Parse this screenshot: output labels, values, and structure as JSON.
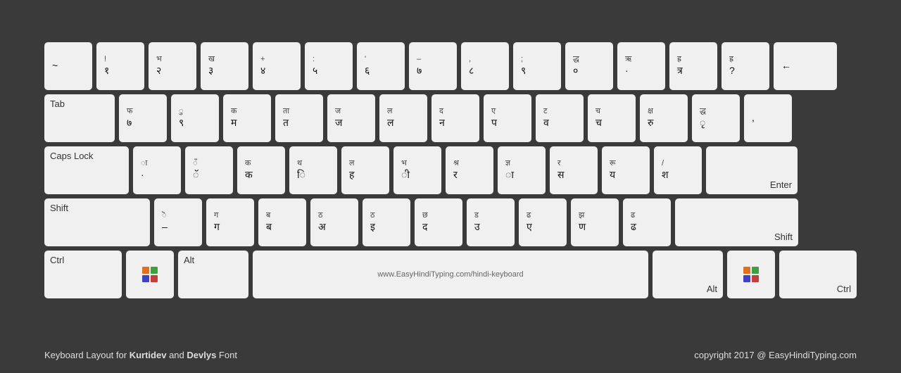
{
  "keyboard": {
    "rows": [
      {
        "id": "row1",
        "keys": [
          {
            "id": "backtick",
            "top": "",
            "bottom": "~",
            "w": "w1"
          },
          {
            "id": "1",
            "top": "!",
            "bottom": "१",
            "w": "w1"
          },
          {
            "id": "2",
            "top": "भ",
            "bottom": "२",
            "w": "w1"
          },
          {
            "id": "3",
            "top": "ख",
            "bottom": "३",
            "w": "w1"
          },
          {
            "id": "4",
            "top": "+",
            "bottom": "४",
            "w": "w1"
          },
          {
            "id": "5",
            "top": ":",
            "bottom": "५",
            "w": "w1"
          },
          {
            "id": "6",
            "top": "'",
            "bottom": "६",
            "w": "w1"
          },
          {
            "id": "7",
            "top": "–",
            "bottom": "७",
            "w": "w1"
          },
          {
            "id": "8",
            "top": ",",
            "bottom": "८",
            "w": "w1"
          },
          {
            "id": "9",
            "top": ";",
            "bottom": "९",
            "w": "w1"
          },
          {
            "id": "0",
            "top": "द्ध",
            "bottom": "०",
            "w": "w1"
          },
          {
            "id": "minus",
            "top": "ऋ",
            "bottom": "·",
            "w": "w1"
          },
          {
            "id": "equal",
            "top": "ह्र",
            "bottom": "त्र",
            "w": "w1"
          },
          {
            "id": "plus2",
            "top": "ह्र",
            "bottom": "?",
            "w": "w1"
          },
          {
            "id": "backspace",
            "top": "",
            "bottom": "←",
            "w": "w-back",
            "special": true
          }
        ]
      },
      {
        "id": "row2",
        "keys": [
          {
            "id": "tab",
            "label": "Tab",
            "w": "w-tab",
            "special": true
          },
          {
            "id": "q",
            "top": "फ",
            "bottom": "७",
            "w": "w1"
          },
          {
            "id": "w",
            "top": "ु",
            "bottom": "९",
            "w": "w1"
          },
          {
            "id": "e",
            "top": "क",
            "bottom": "म",
            "w": "w1"
          },
          {
            "id": "r",
            "top": "ता",
            "bottom": "त",
            "w": "w1"
          },
          {
            "id": "t",
            "top": "ज",
            "bottom": "ज",
            "w": "w1"
          },
          {
            "id": "y",
            "top": "ल",
            "bottom": "ल",
            "w": "w1"
          },
          {
            "id": "u",
            "top": "द",
            "bottom": "न",
            "w": "w1"
          },
          {
            "id": "i",
            "top": "ए",
            "bottom": "प",
            "w": "w1"
          },
          {
            "id": "o",
            "top": "ट",
            "bottom": "व",
            "w": "w1"
          },
          {
            "id": "p",
            "top": "च",
            "bottom": "च",
            "w": "w1"
          },
          {
            "id": "bracketl",
            "top": "क्ष",
            "bottom": "रु",
            "w": "w1"
          },
          {
            "id": "bracketr",
            "top": "द्ध",
            "bottom": "ृ",
            "w": "w1"
          },
          {
            "id": "backslash",
            "top": "",
            "bottom": ",",
            "w": "w1"
          }
        ]
      },
      {
        "id": "row3",
        "keys": [
          {
            "id": "capslock",
            "label": "Caps Lock",
            "w": "w-caps",
            "special": true
          },
          {
            "id": "a",
            "top": "ा",
            "bottom": "·",
            "w": "w1"
          },
          {
            "id": "s",
            "top": "ँ",
            "bottom": "ॅ",
            "w": "w1"
          },
          {
            "id": "d",
            "top": "क",
            "bottom": "क",
            "w": "w1"
          },
          {
            "id": "f",
            "top": "थ",
            "bottom": "ि",
            "w": "w1"
          },
          {
            "id": "g",
            "top": "ल",
            "bottom": "ह",
            "w": "w1"
          },
          {
            "id": "h",
            "top": "भ",
            "bottom": "ी",
            "w": "w1"
          },
          {
            "id": "j",
            "top": "श्र",
            "bottom": "र",
            "w": "w1"
          },
          {
            "id": "k",
            "top": "ज्ञ",
            "bottom": "ा",
            "w": "w1"
          },
          {
            "id": "l",
            "top": "र",
            "bottom": "स",
            "w": "w1"
          },
          {
            "id": "semicolon",
            "top": "रू",
            "bottom": "य",
            "w": "w1"
          },
          {
            "id": "quote",
            "top": "/",
            "bottom": "श",
            "w": "w1"
          },
          {
            "id": "enter",
            "label": "Enter",
            "w": "w-enter",
            "special": true
          }
        ]
      },
      {
        "id": "row4",
        "keys": [
          {
            "id": "shiftl",
            "label": "Shift",
            "w": "w-shift-l",
            "special": true
          },
          {
            "id": "z",
            "top": "ॆ",
            "bottom": "–",
            "w": "w1"
          },
          {
            "id": "x",
            "top": "ग",
            "bottom": "ग",
            "w": "w1"
          },
          {
            "id": "c",
            "top": "ब",
            "bottom": "ब",
            "w": "w1"
          },
          {
            "id": "v",
            "top": "ठ",
            "bottom": "अ",
            "w": "w1"
          },
          {
            "id": "b",
            "top": "ठ",
            "bottom": "इ",
            "w": "w1"
          },
          {
            "id": "n",
            "top": "छ",
            "bottom": "द",
            "w": "w1"
          },
          {
            "id": "m",
            "top": "ड",
            "bottom": "उ",
            "w": "w1"
          },
          {
            "id": "comma",
            "top": "ढ",
            "bottom": "ए",
            "w": "w1"
          },
          {
            "id": "period",
            "top": "झ",
            "bottom": "ण",
            "w": "w1"
          },
          {
            "id": "slash",
            "top": "ढ",
            "bottom": "ढ",
            "w": "w1"
          },
          {
            "id": "shiftr",
            "label": "Shift",
            "w": "w-shift-r",
            "special": true
          }
        ]
      },
      {
        "id": "row5",
        "keys": [
          {
            "id": "ctrll",
            "label": "Ctrl",
            "w": "w-ctrl",
            "special": true
          },
          {
            "id": "winl",
            "label": "win",
            "w": "w-win",
            "special": true,
            "isWin": true
          },
          {
            "id": "altl",
            "label": "Alt",
            "w": "w-alt",
            "special": true
          },
          {
            "id": "space",
            "label": "www.EasyHindiTyping.com/hindi-keyboard",
            "w": "w-space",
            "special": true
          },
          {
            "id": "altr",
            "label": "Alt",
            "w": "w-alt",
            "special": true
          },
          {
            "id": "winr",
            "label": "win",
            "w": "w-win",
            "special": true,
            "isWin": true
          },
          {
            "id": "ctrlr",
            "label": "Ctrl",
            "w": "w-ctrl",
            "special": true
          }
        ]
      }
    ],
    "footer": {
      "left": "Keyboard Layout for Kurtidev and Devlys Font",
      "right": "copyright 2017 @ EasyHindiTyping.com"
    }
  }
}
